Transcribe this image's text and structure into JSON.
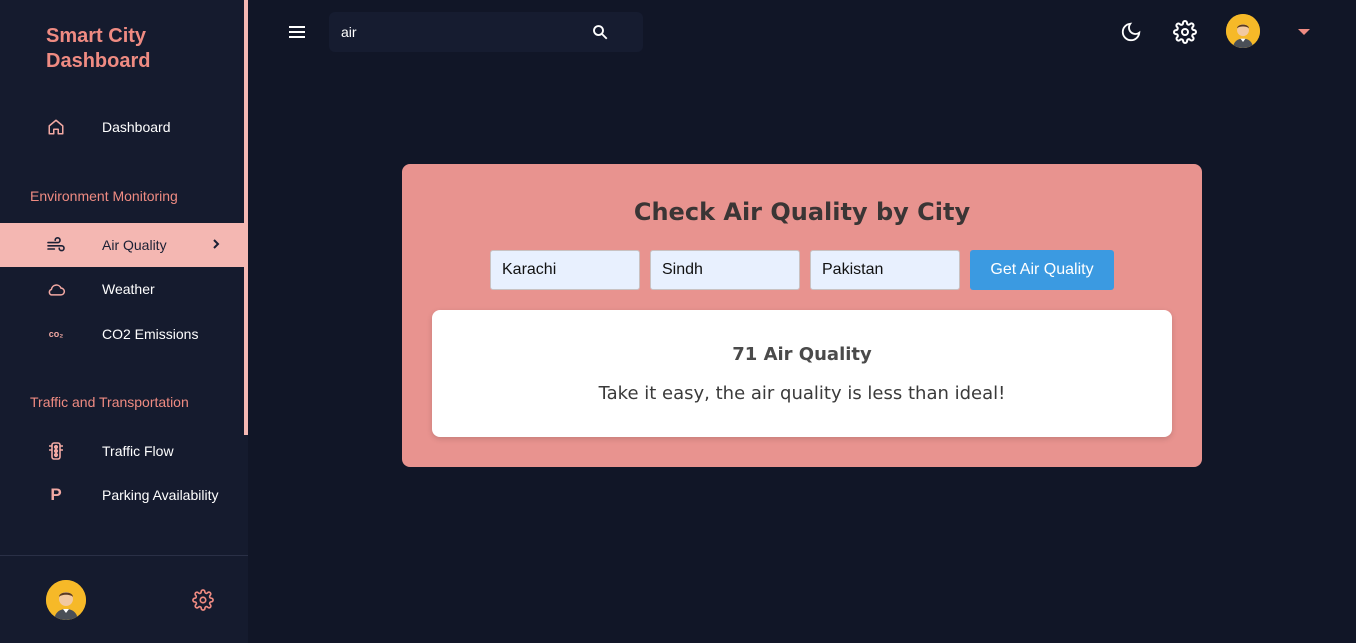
{
  "app": {
    "title": "Smart City Dashboard"
  },
  "sidebar": {
    "dashboard_label": "Dashboard",
    "sections": [
      {
        "label": "Environment Monitoring"
      },
      {
        "label": "Traffic and Transportation"
      }
    ],
    "env_items": [
      {
        "label": "Air Quality",
        "icon": "wind-icon",
        "active": true
      },
      {
        "label": "Weather",
        "icon": "cloud-icon"
      },
      {
        "label": "CO2 Emissions",
        "icon": "co2-icon"
      }
    ],
    "traffic_items": [
      {
        "label": "Traffic Flow",
        "icon": "traffic-light-icon"
      },
      {
        "label": "Parking Availability",
        "icon": "parking-icon"
      }
    ],
    "co2_glyph": "co₂",
    "parking_glyph": "P"
  },
  "topbar": {
    "search_value": "air"
  },
  "air_quality": {
    "title": "Check Air Quality by City",
    "city": "Karachi",
    "state": "Sindh",
    "country": "Pakistan",
    "button_label": "Get Air Quality",
    "result_value": "71 Air Quality",
    "result_message": "Take it easy, the air quality is less than ideal!"
  },
  "colors": {
    "background": "#111627",
    "sidebar": "#151b2e",
    "accent": "#ef8b82",
    "active_item": "#f4b7b2",
    "card": "#e8938f",
    "button": "#3b9ae1"
  }
}
